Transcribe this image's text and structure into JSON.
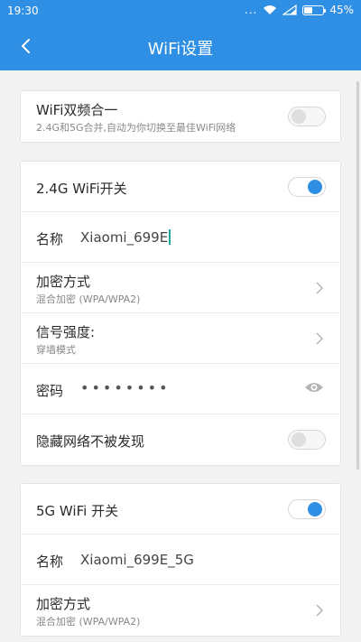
{
  "status": {
    "time": "19:30",
    "dots": "...",
    "battery_pct": "45%",
    "battery_level": 0.45
  },
  "header": {
    "back_icon": "chevron-left-icon",
    "title": "WiFi设置"
  },
  "dual_band": {
    "label": "WiFi双频合一",
    "sub": "2.4G和5G合并,自动为你切换至最佳WiFi网络",
    "enabled": false
  },
  "wifi24": {
    "switch_label": "2.4G WiFi开关",
    "enabled": true,
    "name_label": "名称",
    "name_value": "Xiaomi_699E",
    "encryption_label": "加密方式",
    "encryption_value": "混合加密 (WPA/WPA2)",
    "signal_label": "信号强度:",
    "signal_value": "穿墙模式",
    "password_label": "密码",
    "password_value": "••••••••",
    "hidden_label": "隐藏网络不被发现",
    "hidden_enabled": false
  },
  "wifi5": {
    "switch_label": "5G WiFi 开关",
    "enabled": true,
    "name_label": "名称",
    "name_value": "Xiaomi_699E_5G",
    "encryption_label": "加密方式",
    "encryption_value": "混合加密 (WPA/WPA2)"
  },
  "colors": {
    "accent": "#2f8fe4",
    "background": "#f2f2f2"
  }
}
